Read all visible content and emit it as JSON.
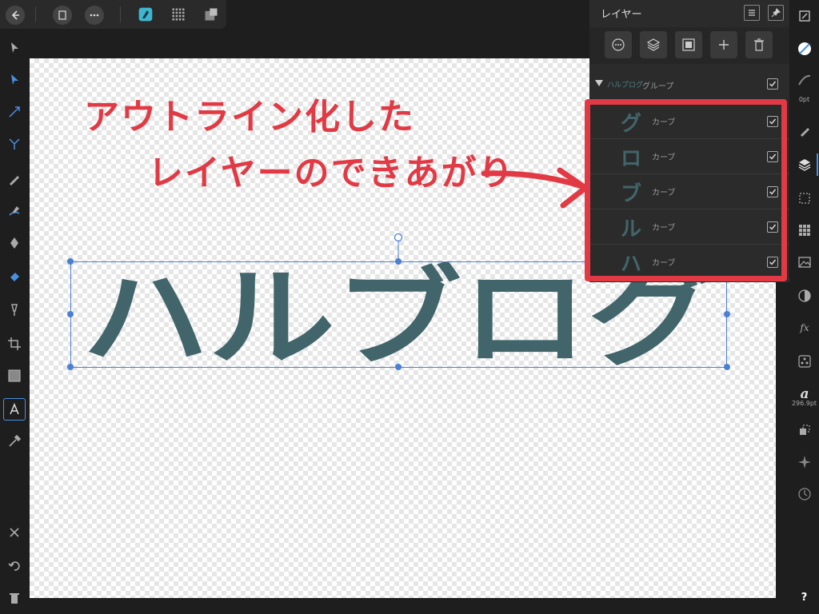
{
  "top_toolbar": {
    "back_icon": "back-arrow-icon",
    "document_icon": "document-icon",
    "more_icon": "more-dots-icon",
    "personas": [
      "designer-persona-icon",
      "pixel-persona-icon",
      "export-persona-icon"
    ]
  },
  "canvas": {
    "big_text": "ハルブログ",
    "annotation_line1": "アウトライン化した",
    "annotation_line2": "レイヤーのできあがり"
  },
  "layers_panel": {
    "title": "レイヤー",
    "group": {
      "thumb": "ハルブログ",
      "label": "グループ"
    },
    "items": [
      {
        "thumb": "グ",
        "label": "カーブ",
        "checked": true
      },
      {
        "thumb": "ロ",
        "label": "カーブ",
        "checked": true
      },
      {
        "thumb": "ブ",
        "label": "カーブ",
        "checked": true
      },
      {
        "thumb": "ル",
        "label": "カーブ",
        "checked": true
      },
      {
        "thumb": "ハ",
        "label": "カーブ",
        "checked": true
      }
    ]
  },
  "studio": {
    "stroke_width": "0pt",
    "font_size": "296.9pt",
    "help": "?"
  },
  "colors": {
    "text_fill": "#41656a",
    "annotation": "#e23a44",
    "selection": "#4a7fd6"
  }
}
